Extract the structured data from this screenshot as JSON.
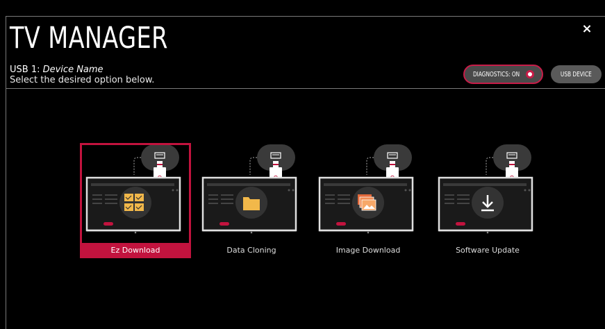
{
  "header": {
    "title": "TV MANAGER",
    "usb_prefix": "USB 1:",
    "device_name": "Device Name",
    "instruction": "Select the desired option below."
  },
  "controls": {
    "close_label": "×",
    "diagnostics_label": "DIAGNOSTICS: ON",
    "usb_device_label": "USB DEVICE"
  },
  "options": [
    {
      "label": "Ez Download",
      "icon": "ez-download-icon",
      "selected": true
    },
    {
      "label": "Data Cloning",
      "icon": "folder-icon",
      "selected": false
    },
    {
      "label": "Image Download",
      "icon": "images-icon",
      "selected": false
    },
    {
      "label": "Software Update",
      "icon": "download-arrow-icon",
      "selected": false
    }
  ],
  "colors": {
    "accent": "#c2133e",
    "background": "#000000",
    "pill": "#4a4a4a"
  }
}
